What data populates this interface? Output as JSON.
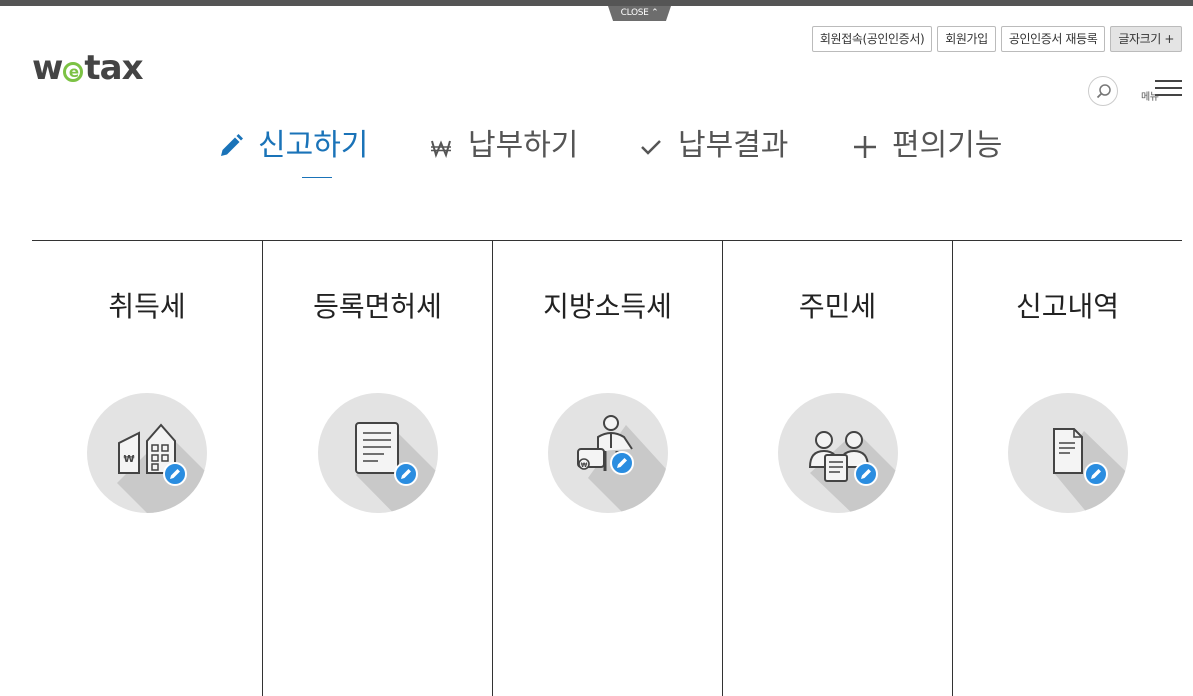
{
  "close_tab": {
    "label": "CLOSE"
  },
  "logo": {
    "pre": "w",
    "e": "e",
    "post": "tax"
  },
  "util_buttons": [
    {
      "label": "회원접속(공인인증서)"
    },
    {
      "label": "회원가입"
    },
    {
      "label": "공인인증서 재등록"
    },
    {
      "label": "글자크기 +"
    }
  ],
  "menu": {
    "label": "메뉴"
  },
  "gnb": [
    {
      "label": "신고하기",
      "icon": "pencil-icon",
      "active": true
    },
    {
      "label": "납부하기",
      "icon": "won-icon",
      "active": false
    },
    {
      "label": "납부결과",
      "icon": "check-icon",
      "active": false
    },
    {
      "label": "편의기능",
      "icon": "plus-icon",
      "active": false
    }
  ],
  "categories": [
    {
      "label": "취득세",
      "icon": "building-won-icon"
    },
    {
      "label": "등록면허세",
      "icon": "document-icon"
    },
    {
      "label": "지방소득세",
      "icon": "businessman-icon"
    },
    {
      "label": "주민세",
      "icon": "people-icon"
    },
    {
      "label": "신고내역",
      "icon": "file-icon"
    }
  ],
  "colors": {
    "accent": "#1a73b8",
    "pen_badge": "#2a8de0",
    "logo_green": "#7cc244",
    "circle_bg": "#e3e3e3"
  }
}
